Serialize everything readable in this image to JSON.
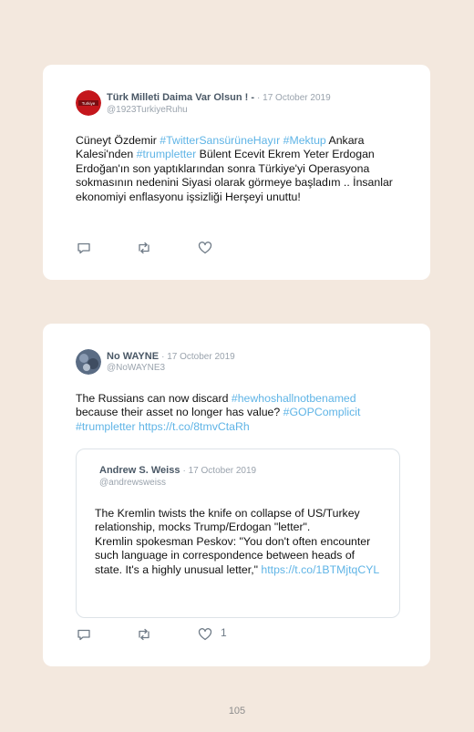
{
  "tweets": [
    {
      "author": "Türk Milleti Daima Var Olsun ! -",
      "date": "· 17 October 2019",
      "handle": "@1923TurkiyeRuhu",
      "avatar_color": "#c4161c",
      "avatar_label": "Turkiye",
      "text_parts": [
        {
          "t": "Cüneyt Özdemir ",
          "link": false
        },
        {
          "t": "#TwitterSansürüneHayır",
          "link": true
        },
        {
          "t": " ",
          "link": false
        },
        {
          "t": "#Mektup",
          "link": true
        },
        {
          "t": " Ankara Kalesi'nden ",
          "link": false
        },
        {
          "t": "#trumpletter",
          "link": true
        },
        {
          "t": " Bülent Ecevit Ekrem Yeter Erdogan Erdoğan'ın son yaptıklarından sonra Türkiye'yi Operasyona sokmasının nedenini Siyasi olarak görmeye başladım .. İnsanlar ekonomiyi enflasyonu işsizliği Herşeyi unuttu!",
          "link": false
        }
      ],
      "actions": {
        "reply_icon": "reply-icon",
        "retweet_icon": "retweet-icon",
        "like_icon": "heart-icon",
        "like_count": ""
      }
    },
    {
      "author": "No WAYNE",
      "date": "· 17 October 2019",
      "handle": "@NoWAYNE3",
      "avatar_color": "#5a6c84",
      "text_parts": [
        {
          "t": "The Russians can now discard ",
          "link": false
        },
        {
          "t": "#hewhoshallnotbenamed",
          "link": true
        },
        {
          "t": " because their asset no longer has value? ",
          "link": false
        },
        {
          "t": "#GOPComplicit",
          "link": true
        },
        {
          "t": " ",
          "link": false
        },
        {
          "t": "#trumpletter",
          "link": true
        },
        {
          "t": " ",
          "link": false
        },
        {
          "t": "https://t.co/8tmvCtaRh",
          "link": true
        }
      ],
      "quote": {
        "author": "Andrew S. Weiss",
        "date": "· 17 October 2019",
        "handle": "@andrewsweiss",
        "text_parts": [
          {
            "t": "The Kremlin twists the knife on collapse of US/Turkey relationship, mocks Trump/Erdogan \"letter\".",
            "link": false,
            "br": true
          },
          {
            "t": "Kremlin spokesman Peskov: \"You don't often encounter such language in correspondence between heads of state. It's a highly unusual letter,\" ",
            "link": false
          },
          {
            "t": "https://t.co/1BTMjtqCYL",
            "link": true
          }
        ]
      },
      "actions": {
        "reply_icon": "reply-icon",
        "retweet_icon": "retweet-icon",
        "like_icon": "heart-icon",
        "like_count": "1"
      }
    }
  ],
  "page_number": "105",
  "colors": {
    "background": "#f3e8de",
    "card": "#ffffff",
    "link": "#5fb4e6",
    "meta": "#9aa3ad",
    "author": "#4a5866"
  }
}
